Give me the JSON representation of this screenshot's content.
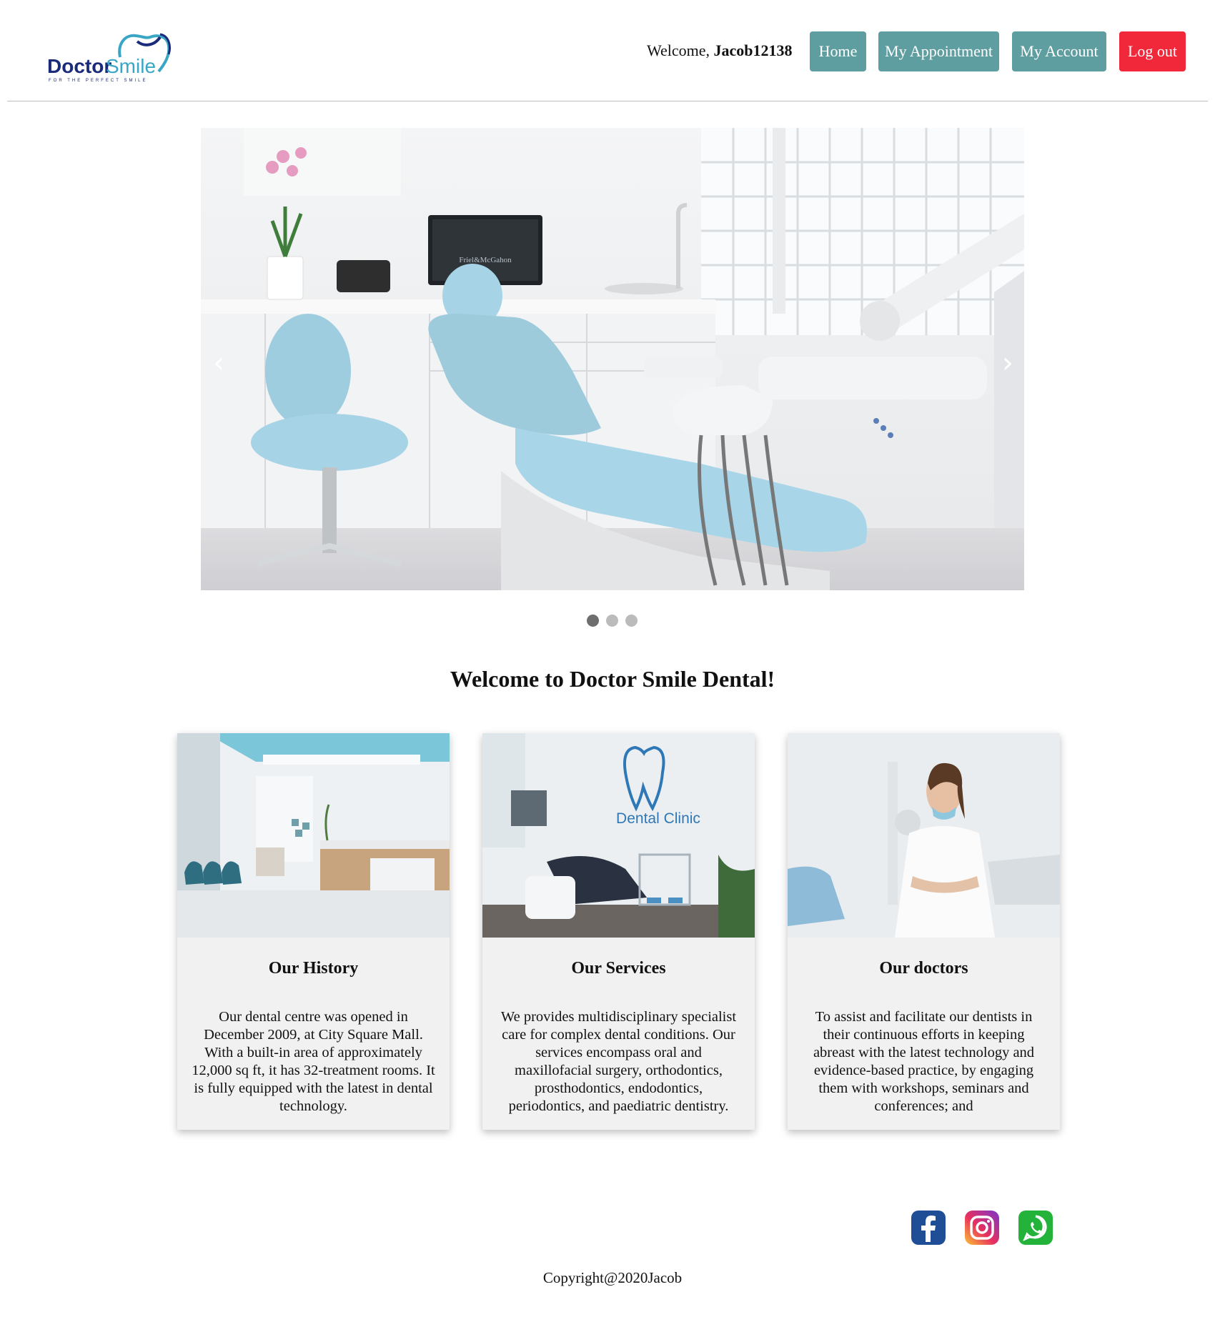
{
  "header": {
    "logo_text_primary": "Doctor",
    "logo_text_secondary": "Smile",
    "logo_tagline": "FOR THE PERFECT SMILE",
    "welcome_prefix": "Welcome, ",
    "username": "Jacob12138",
    "nav": [
      {
        "label": "Home",
        "color": "#5f9ea0"
      },
      {
        "label": "My Appointment",
        "color": "#5f9ea0"
      },
      {
        "label": "My Account",
        "color": "#5f9ea0"
      },
      {
        "label": "Log out",
        "color": "#f0283a"
      }
    ]
  },
  "carousel": {
    "prev_icon": "‹",
    "next_icon": "›",
    "slide_count": 3,
    "active_slide": 1,
    "monitor_text": "Friel&McGahon"
  },
  "main": {
    "title": "Welcome to Doctor Smile Dental!",
    "cards": [
      {
        "title": "Our History",
        "body": "Our dental centre was opened in December 2009, at City Square Mall. With a built-in area of approximately 12,000 sq ft, it has 32-treatment rooms. It is fully equipped with the latest in dental technology."
      },
      {
        "title": "Our Services",
        "body": "We provides multidisciplinary specialist care for complex dental conditions. Our services encompass oral and maxillofacial surgery, orthodontics, prosthodontics, endodontics, periodontics, and paediatric dentistry.",
        "image_text": "Dental Clinic"
      },
      {
        "title": "Our doctors",
        "body": "To assist and facilitate our dentists in their continuous efforts in keeping abreast with the latest technology and evidence-based practice, by engaging them with workshops, seminars and conferences; and"
      }
    ]
  },
  "footer": {
    "social": [
      "facebook-icon",
      "instagram-icon",
      "whatsapp-icon"
    ],
    "copyright": "Copyright@2020Jacob"
  }
}
